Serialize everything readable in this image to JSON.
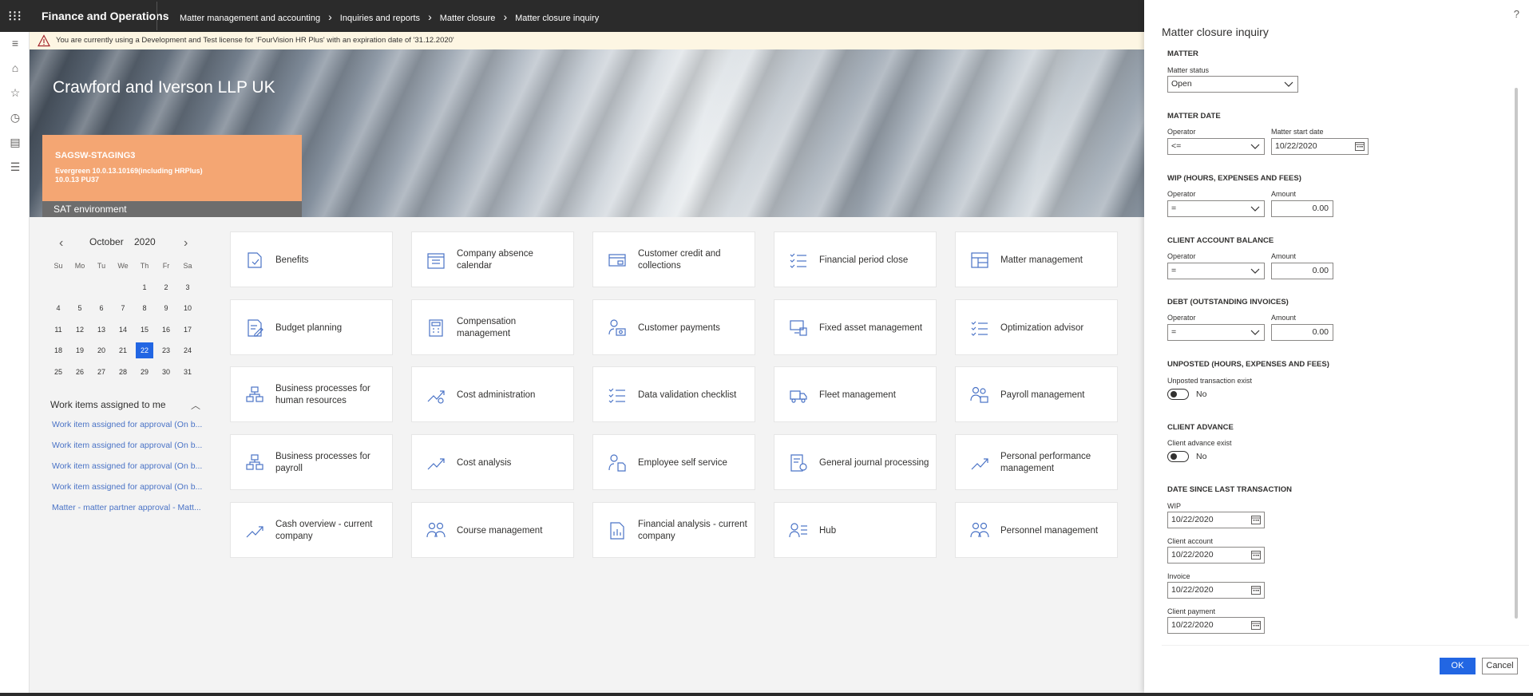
{
  "app": {
    "brand": "Finance and Operations",
    "breadcrumb": [
      "Matter management and accounting",
      "Inquiries and reports",
      "Matter closure",
      "Matter closure inquiry"
    ]
  },
  "license": {
    "message": "You are currently using a Development and Test license for 'FourVision HR Plus' with an expiration date of '31.12.2020'"
  },
  "banner": {
    "company": "Crawford and Iverson LLP UK",
    "env_name": "SAGSW-STAGING3",
    "env_line1": "Evergreen 10.0.13.10169(including HRPlus)",
    "env_line2": "10.0.13 PU37",
    "env_type": "SAT environment"
  },
  "calendar": {
    "month": "October",
    "year": "2020",
    "prev": "‹",
    "next": "›",
    "weekdays": [
      "Su",
      "Mo",
      "Tu",
      "We",
      "Th",
      "Fr",
      "Sa"
    ],
    "weeks": [
      [
        "",
        "",
        "",
        "",
        "1",
        "2",
        "3"
      ],
      [
        "4",
        "5",
        "6",
        "7",
        "8",
        "9",
        "10"
      ],
      [
        "11",
        "12",
        "13",
        "14",
        "15",
        "16",
        "17"
      ],
      [
        "18",
        "19",
        "20",
        "21",
        "22",
        "23",
        "24"
      ],
      [
        "25",
        "26",
        "27",
        "28",
        "29",
        "30",
        "31"
      ]
    ],
    "today": "22"
  },
  "work_items": {
    "title": "Work items assigned to me",
    "items": [
      "Work item assigned for approval (On b...",
      "Work item assigned for approval (On b...",
      "Work item assigned for approval (On b...",
      "Work item assigned for approval (On b...",
      "Matter - matter partner approval - Matt..."
    ]
  },
  "tiles": [
    {
      "label": "Benefits",
      "icon": "benefits-icon"
    },
    {
      "label": "Company absence calendar",
      "icon": "calendar-icon"
    },
    {
      "label": "Customer credit and collections",
      "icon": "credit-card-icon"
    },
    {
      "label": "Financial period close",
      "icon": "checklist-icon"
    },
    {
      "label": "Matter management",
      "icon": "dashboard-icon"
    },
    {
      "label": "Budget planning",
      "icon": "edit-document-icon"
    },
    {
      "label": "Compensation management",
      "icon": "calculator-icon"
    },
    {
      "label": "Customer payments",
      "icon": "person-money-icon"
    },
    {
      "label": "Fixed asset management",
      "icon": "computer-icon"
    },
    {
      "label": "Optimization advisor",
      "icon": "checklist-icon"
    },
    {
      "label": "Business processes for human resources",
      "icon": "process-icon"
    },
    {
      "label": "Cost administration",
      "icon": "trend-gear-icon"
    },
    {
      "label": "Data validation checklist",
      "icon": "checklist-icon"
    },
    {
      "label": "Fleet management",
      "icon": "truck-icon"
    },
    {
      "label": "Payroll management",
      "icon": "people-money-icon"
    },
    {
      "label": "Business processes for payroll",
      "icon": "process-icon"
    },
    {
      "label": "Cost analysis",
      "icon": "trend-icon"
    },
    {
      "label": "Employee self service",
      "icon": "person-doc-icon"
    },
    {
      "label": "General journal processing",
      "icon": "journal-icon"
    },
    {
      "label": "Personal performance management",
      "icon": "trend-icon"
    },
    {
      "label": "Cash overview - current company",
      "icon": "trend-icon"
    },
    {
      "label": "Course management",
      "icon": "people-icon"
    },
    {
      "label": "Financial analysis - current company",
      "icon": "report-icon"
    },
    {
      "label": "Hub",
      "icon": "person-list-icon"
    },
    {
      "label": "Personnel management",
      "icon": "people-icon"
    }
  ],
  "panel": {
    "help": "?",
    "title": "Matter closure inquiry",
    "matter": {
      "section": "MATTER",
      "status_label": "Matter status",
      "status_value": "Open"
    },
    "matter_date": {
      "section": "MATTER DATE",
      "operator_label": "Operator",
      "operator_value": "<=",
      "date_label": "Matter start date",
      "date_value": "10/22/2020"
    },
    "wip": {
      "section": "WIP (HOURS, EXPENSES AND FEES)",
      "operator_label": "Operator",
      "operator_value": "=",
      "amount_label": "Amount",
      "amount_value": "0.00"
    },
    "client_balance": {
      "section": "CLIENT ACCOUNT BALANCE",
      "operator_label": "Operator",
      "operator_value": "=",
      "amount_label": "Amount",
      "amount_value": "0.00"
    },
    "debt": {
      "section": "DEBT (OUTSTANDING INVOICES)",
      "operator_label": "Operator",
      "operator_value": "=",
      "amount_label": "Amount",
      "amount_value": "0.00"
    },
    "unposted": {
      "section": "UNPOSTED (HOURS, EXPENSES AND FEES)",
      "label": "Unposted transaction exist",
      "value": "No"
    },
    "client_advance": {
      "section": "CLIENT ADVANCE",
      "label": "Client advance exist",
      "value": "No"
    },
    "last_transaction": {
      "section": "DATE SINCE LAST TRANSACTION",
      "wip_label": "WIP",
      "wip_value": "10/22/2020",
      "client_account_label": "Client account",
      "client_account_value": "10/22/2020",
      "invoice_label": "Invoice",
      "invoice_value": "10/22/2020",
      "client_payment_label": "Client payment",
      "client_payment_value": "10/22/2020"
    },
    "ok_label": "OK",
    "cancel_label": "Cancel"
  },
  "colors": {
    "accent": "#2266e3",
    "topbar": "#2b2b2b",
    "env_orange": "#f4a673",
    "link": "#4a73c6",
    "icon_blue": "#4a73c6"
  }
}
